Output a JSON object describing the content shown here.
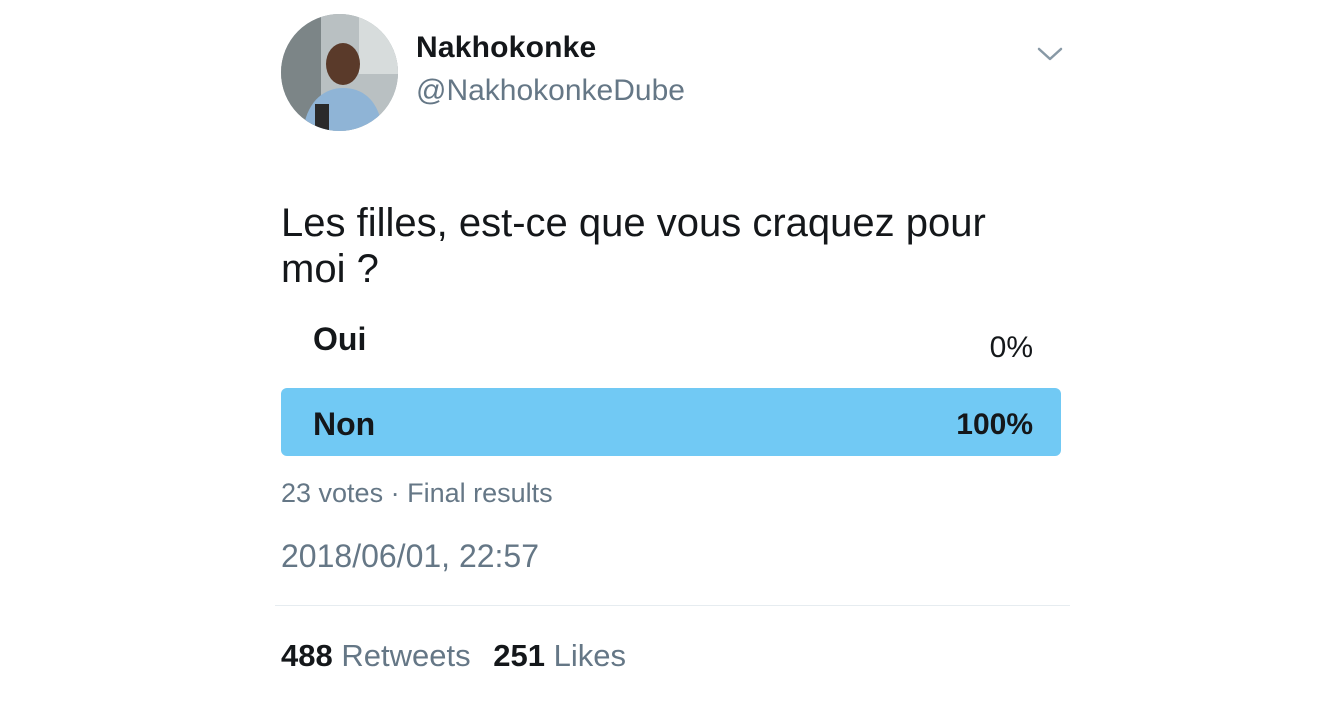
{
  "tweet": {
    "display_name": "Nakhokonke",
    "handle": "@NakhokonkeDube",
    "text": "Les filles, est-ce que vous craquez pour moi ?",
    "menu_icon": "chevron-down-icon",
    "avatar": "user profile photo"
  },
  "poll": {
    "options": [
      {
        "label": "Oui",
        "percent_label": "0%",
        "fraction": 0.0
      },
      {
        "label": "Non",
        "percent_label": "100%",
        "fraction": 1.0
      }
    ],
    "votes": "23 votes",
    "separator": "·",
    "status": "Final results",
    "winner_color": "#71c9f4"
  },
  "timestamp": "2018/06/01, 22:57",
  "stats": {
    "retweets_count": "488",
    "retweets_label": "Retweets",
    "likes_count": "251",
    "likes_label": "Likes"
  },
  "colors": {
    "text_primary": "#14171a",
    "text_secondary": "#657786",
    "divider": "#e6ecf0"
  }
}
